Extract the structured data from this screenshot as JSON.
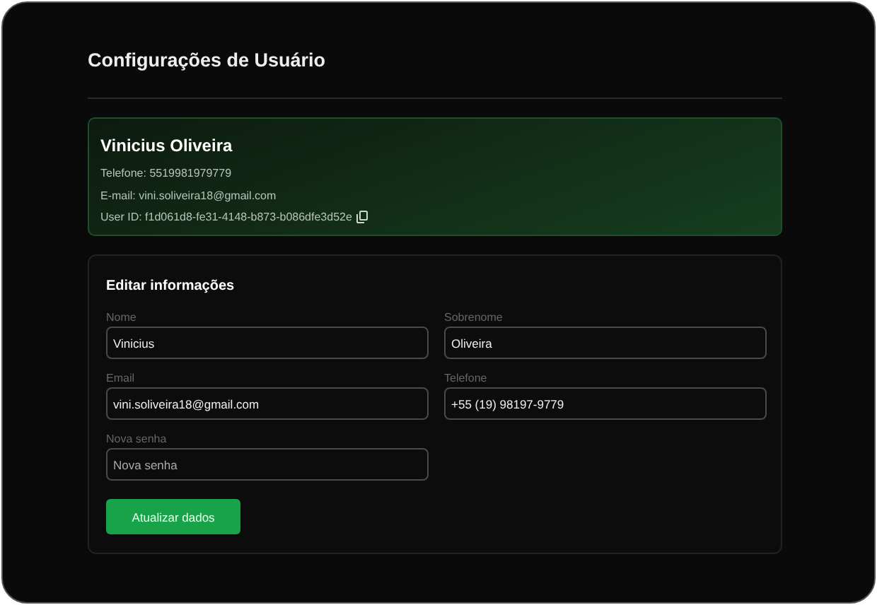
{
  "page": {
    "title": "Configurações de Usuário"
  },
  "profile": {
    "name": "Vinicius Oliveira",
    "phone": "Telefone: 5519981979779",
    "email": "E-mail: vini.soliveira18@gmail.com",
    "user_id": "User ID: f1d061d8-fe31-4148-b873-b086dfe3d52e"
  },
  "form": {
    "title": "Editar informações",
    "fields": [
      {
        "label": "Nome",
        "value": "Vinicius"
      },
      {
        "label": "Sobrenome",
        "value": "Oliveira"
      },
      {
        "label": "Email",
        "value": "vini.soliveira18@gmail.com"
      },
      {
        "label": "Telefone",
        "value": "+55 (19) 98197-9779"
      },
      {
        "label": "Nova senha",
        "placeholder": "Nova senha"
      }
    ],
    "submit": "Atualizar dados"
  }
}
